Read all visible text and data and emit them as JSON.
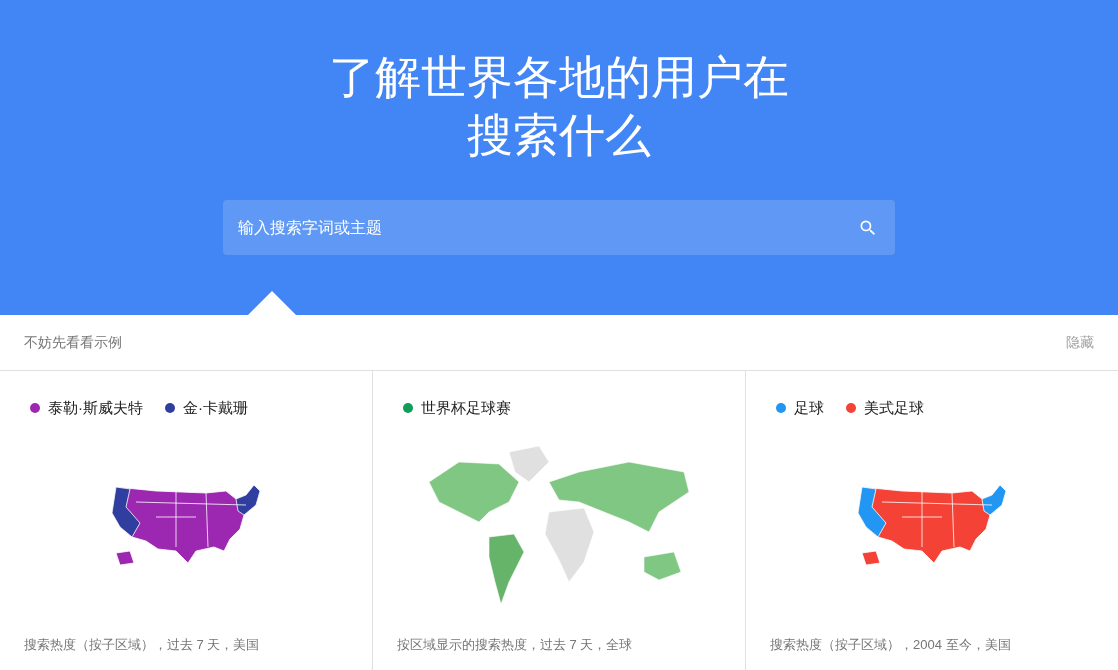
{
  "hero": {
    "title_lines": [
      "了解世界各地的用户在",
      "搜索什么"
    ],
    "search": {
      "placeholder": "输入搜索字词或主题"
    }
  },
  "examples_bar": {
    "label": "不妨先看看示例",
    "hide_link": "隐藏"
  },
  "examples": [
    {
      "kind": "us",
      "second_dominant": false,
      "legend": [
        {
          "label": "泰勒·斯威夫特",
          "color": "#9c27b0"
        },
        {
          "label": "金·卡戴珊",
          "color": "#303f9f"
        }
      ],
      "caption": "搜索热度（按子区域），过去 7 天，美国"
    },
    {
      "kind": "world",
      "legend": [
        {
          "label": "世界杯足球赛",
          "color": "#0f9d58"
        }
      ],
      "caption": "按区域显示的搜索热度，过去 7 天，全球"
    },
    {
      "kind": "us",
      "second_dominant": true,
      "legend": [
        {
          "label": "足球",
          "color": "#2196f3"
        },
        {
          "label": "美式足球",
          "color": "#f44336"
        }
      ],
      "caption": "搜索热度（按子区域），2004 至今，美国"
    }
  ]
}
